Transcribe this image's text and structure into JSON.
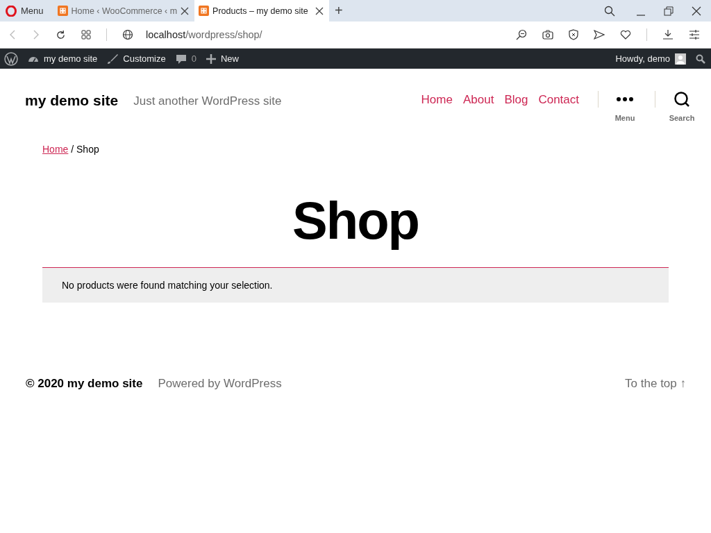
{
  "browser": {
    "menu_label": "Menu",
    "tabs": [
      {
        "title": "Home ‹ WooCommerce ‹ m",
        "selected": false
      },
      {
        "title": "Products – my demo site",
        "selected": true
      }
    ],
    "new_tab": "+",
    "address": {
      "host": "localhost",
      "path": "/wordpress/shop/"
    }
  },
  "admin_bar": {
    "site": "my demo site",
    "customize": "Customize",
    "comments": "0",
    "new": "New",
    "howdy": "Howdy, demo"
  },
  "header": {
    "site_title": "my demo site",
    "tagline": "Just another WordPress site",
    "nav": [
      {
        "label": "Home"
      },
      {
        "label": "About"
      },
      {
        "label": "Blog"
      },
      {
        "label": "Contact"
      }
    ],
    "menu_label": "Menu",
    "search_label": "Search"
  },
  "breadcrumb": {
    "link": "Home",
    "current": " / Shop"
  },
  "page_title": "Shop",
  "notice": "No products were found matching your selection.",
  "footer": {
    "copyright": "© 2020 my demo site",
    "powered": "Powered by WordPress",
    "to_top": "To the top ↑"
  }
}
